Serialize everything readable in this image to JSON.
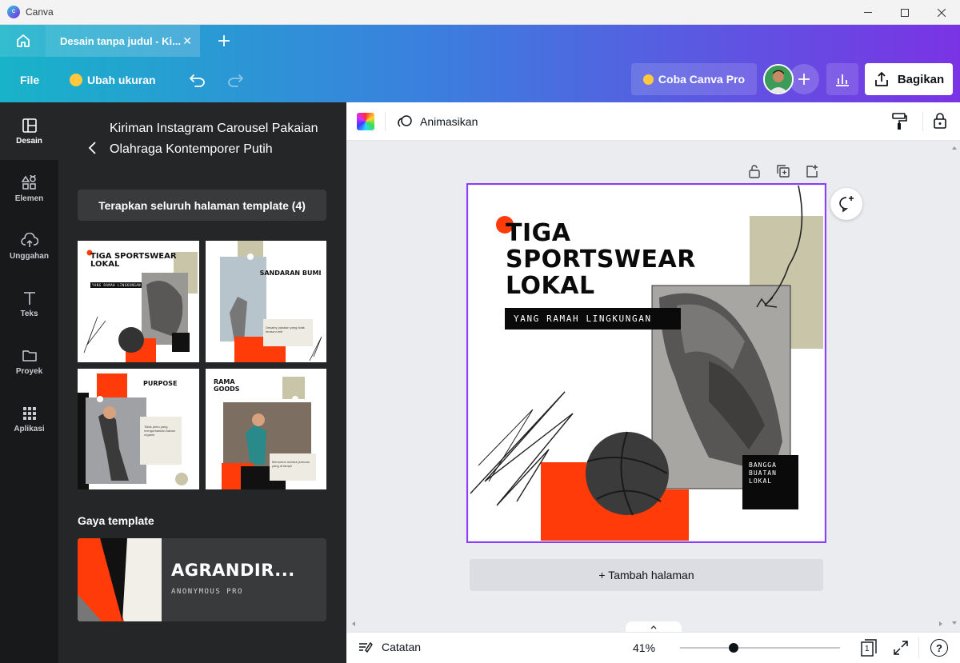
{
  "window": {
    "title": "Canva"
  },
  "tabs": [
    {
      "label": "Desain tanpa judul - Ki..."
    }
  ],
  "menu": {
    "file": "File",
    "resize": "Ubah ukuran",
    "pro": "Coba Canva Pro",
    "share": "Bagikan"
  },
  "rail": [
    {
      "label": "Desain",
      "icon": "layout-icon",
      "active": true
    },
    {
      "label": "Elemen",
      "icon": "shapes-icon"
    },
    {
      "label": "Unggahan",
      "icon": "cloud-upload-icon"
    },
    {
      "label": "Teks",
      "icon": "text-icon"
    },
    {
      "label": "Proyek",
      "icon": "folder-icon"
    },
    {
      "label": "Aplikasi",
      "icon": "grid-icon"
    }
  ],
  "panel": {
    "title": "Kiriman Instagram Carousel Pakaian Olahraga Kontemporer Putih",
    "apply_label": "Terapkan seluruh halaman template (4)",
    "thumbs": [
      {
        "title": "TIGA SPORTSWEAR LOKAL",
        "sub": "YANG RAMAH LINGKUNGAN"
      },
      {
        "title": "SANDARAN BUMI",
        "sub": "Desainy pakaian yang tidak terasa rumit"
      },
      {
        "title": "PURPOSE",
        "sub": "Tidak perlu yang mengorbankan bahan organik"
      },
      {
        "title": "RAMA GOODS",
        "sub": "Menonton melalui jemuran yang di tampil"
      }
    ],
    "style_section": "Gaya template",
    "style_name": "AGRANDIR...",
    "style_font": "ANONYMOUS PRO"
  },
  "toolbar": {
    "animate": "Animasikan"
  },
  "design": {
    "headline": [
      "TIGA",
      "SPORTSWEAR",
      "LOKAL"
    ],
    "tagline": "YANG RAMAH LINGKUNGAN",
    "badge": [
      "BANGGA",
      "BUATAN",
      "LOKAL"
    ]
  },
  "canvas": {
    "add_page": "+ Tambah halaman"
  },
  "footer": {
    "notes": "Catatan",
    "zoom": "41%",
    "zoom_fraction": 0.41,
    "page_count": "1"
  },
  "colors": {
    "accent": "#8b3dff",
    "orange": "#ff3b0a",
    "khaki": "#c9c5a8",
    "dark": "#18191b"
  }
}
